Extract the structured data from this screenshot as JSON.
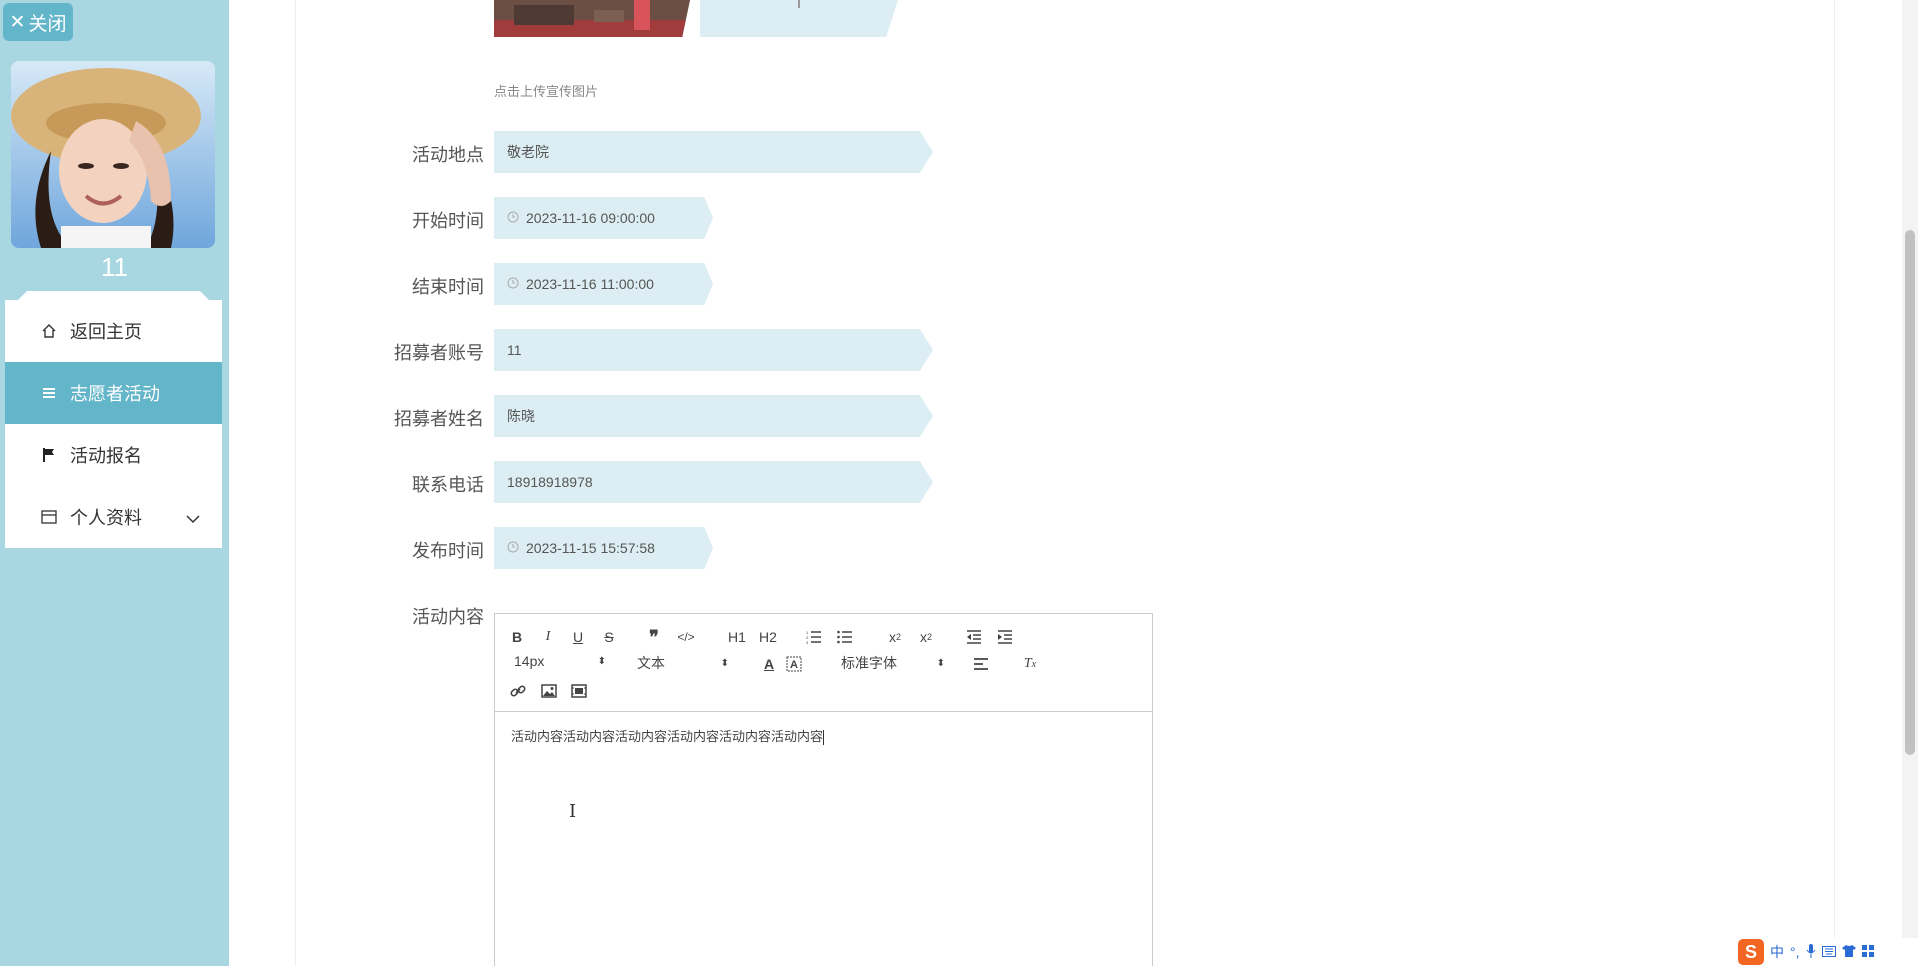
{
  "sidebar": {
    "close_label": "关闭",
    "username": "11",
    "menu": [
      {
        "label": "返回主页",
        "icon": "home-icon"
      },
      {
        "label": "志愿者活动",
        "icon": "list-icon",
        "active": true
      },
      {
        "label": "活动报名",
        "icon": "flag-icon"
      },
      {
        "label": "个人资料",
        "icon": "card-icon",
        "has_submenu": true
      }
    ]
  },
  "form": {
    "upload_hint": "点击上传宣传图片",
    "location": {
      "label": "活动地点",
      "value": "敬老院"
    },
    "start_time": {
      "label": "开始时间",
      "value": "2023-11-16 09:00:00"
    },
    "end_time": {
      "label": "结束时间",
      "value": "2023-11-16 11:00:00"
    },
    "recruiter_account": {
      "label": "招募者账号",
      "value": "11"
    },
    "recruiter_name": {
      "label": "招募者姓名",
      "value": "陈晓"
    },
    "phone": {
      "label": "联系电话",
      "value": "18918918978"
    },
    "publish_time": {
      "label": "发布时间",
      "value": "2023-11-15 15:57:58"
    },
    "content": {
      "label": "活动内容",
      "value": "活动内容活动内容活动内容活动内容活动内容活动内容"
    }
  },
  "editor": {
    "font_size": "14px",
    "paragraph": "文本",
    "font_family": "标准字体",
    "h1": "H1",
    "h2": "H2"
  },
  "ime": {
    "mode": "中"
  },
  "colors": {
    "sidebar_bg": "#a8d6e1",
    "accent": "#63b5c9",
    "field_bg": "#dceef3"
  }
}
